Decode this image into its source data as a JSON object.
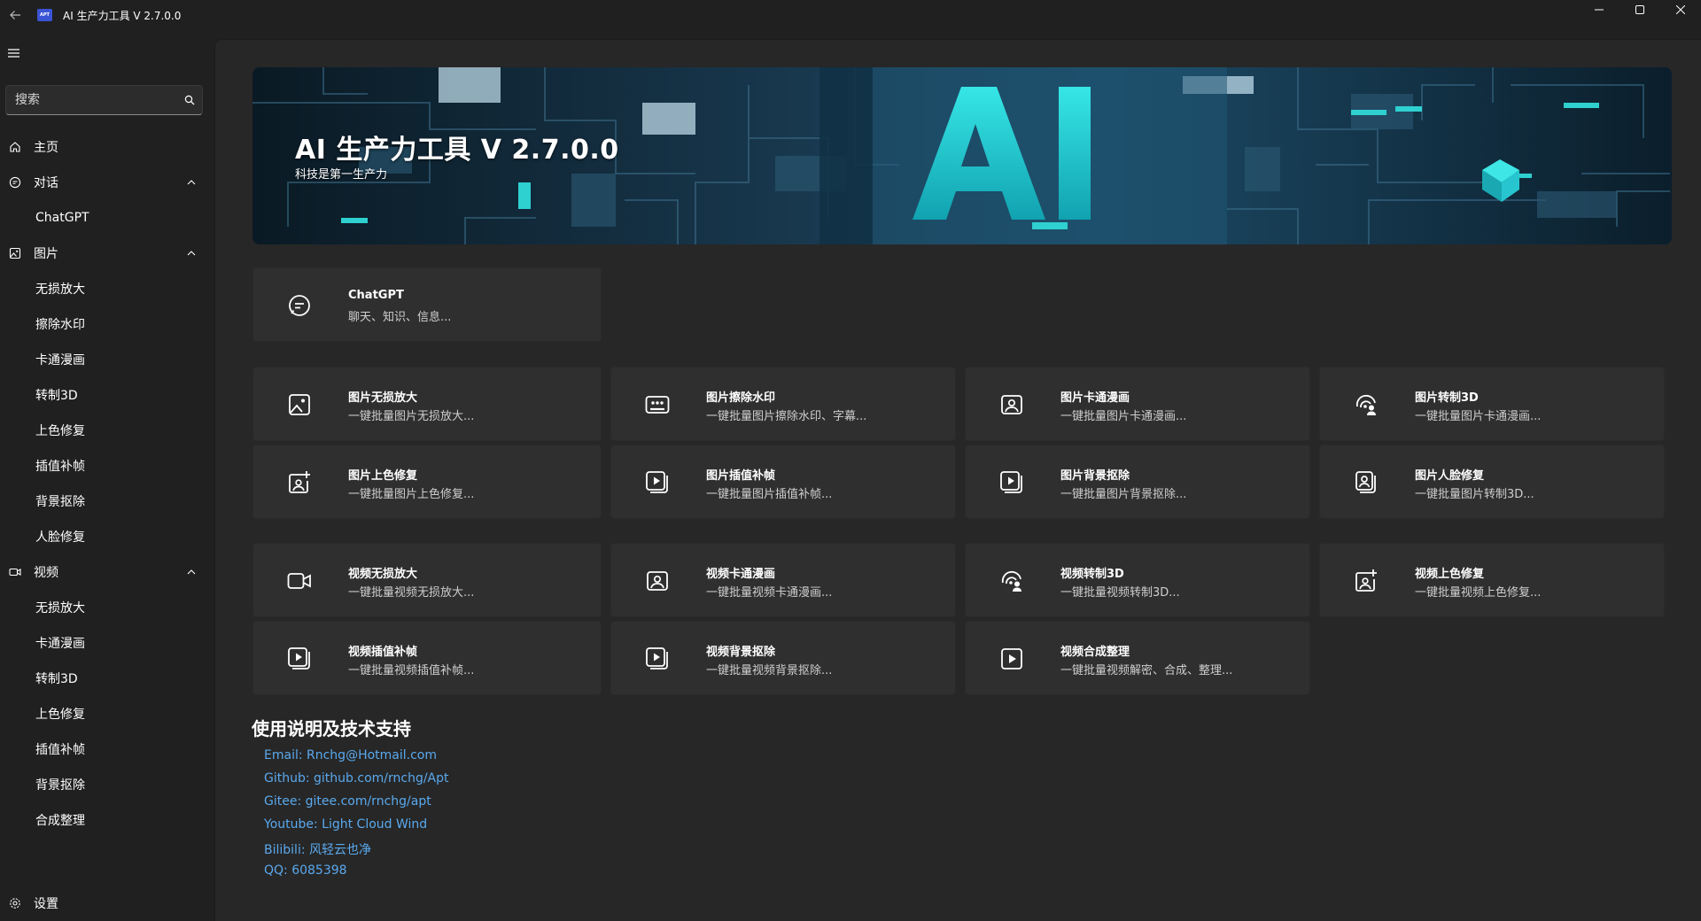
{
  "window": {
    "title": "AI 生产力工具 V 2.7.0.0",
    "logo_text": "APT"
  },
  "search": {
    "placeholder": "搜索"
  },
  "nav": {
    "home": "主页",
    "chat": {
      "label": "对话",
      "items": [
        "ChatGPT"
      ]
    },
    "image": {
      "label": "图片",
      "items": [
        "无损放大",
        "擦除水印",
        "卡通漫画",
        "转制3D",
        "上色修复",
        "插值补帧",
        "背景抠除",
        "人脸修复"
      ]
    },
    "video": {
      "label": "视频",
      "items": [
        "无损放大",
        "卡通漫画",
        "转制3D",
        "上色修复",
        "插值补帧",
        "背景抠除",
        "合成整理"
      ]
    },
    "settings": "设置"
  },
  "hero": {
    "title": "AI 生产力工具 V 2.7.0.0",
    "subtitle": "科技是第一生产力"
  },
  "cards": {
    "chatgpt": {
      "title": "ChatGPT",
      "desc": "聊天、知识、信息...",
      "icon": "chat-icon"
    },
    "image": [
      {
        "title": "图片无损放大",
        "desc": "一键批量图片无损放大...",
        "icon": "image-icon"
      },
      {
        "title": "图片擦除水印",
        "desc": "一键批量图片擦除水印、字幕...",
        "icon": "photo-grid-icon"
      },
      {
        "title": "图片卡通漫画",
        "desc": "一键批量图片卡通漫画...",
        "icon": "portrait-icon"
      },
      {
        "title": "图片转制3D",
        "desc": "一键批量图片卡通漫画...",
        "icon": "radar-person-icon"
      },
      {
        "title": "图片上色修复",
        "desc": "一键批量图片上色修复...",
        "icon": "image-sparkle-icon"
      },
      {
        "title": "图片插值补帧",
        "desc": "一键批量图片插值补帧...",
        "icon": "play-frames-icon"
      },
      {
        "title": "图片背景抠除",
        "desc": "一键批量图片背景抠除...",
        "icon": "play-frames-icon"
      },
      {
        "title": "图片人脸修复",
        "desc": "一键批量图片转制3D...",
        "icon": "face-icon"
      }
    ],
    "video": [
      {
        "title": "视频无损放大",
        "desc": "一键批量视频无损放大...",
        "icon": "video-camera-icon"
      },
      {
        "title": "视频卡通漫画",
        "desc": "一键批量视频卡通漫画...",
        "icon": "portrait-icon"
      },
      {
        "title": "视频转制3D",
        "desc": "一键批量视频转制3D...",
        "icon": "radar-person-icon"
      },
      {
        "title": "视频上色修复",
        "desc": "一键批量视频上色修复...",
        "icon": "image-sparkle-icon"
      },
      {
        "title": "视频插值补帧",
        "desc": "一键批量视频插值补帧...",
        "icon": "play-frames-icon"
      },
      {
        "title": "视频背景抠除",
        "desc": "一键批量视频背景抠除...",
        "icon": "play-frames-icon"
      },
      {
        "title": "视频合成整理",
        "desc": "一键批量视频解密、合成、整理...",
        "icon": "play-box-icon"
      }
    ]
  },
  "support": {
    "heading": "使用说明及技术支持",
    "links": [
      "Email: Rnchg@Hotmail.com",
      "Github: github.com/rnchg/Apt",
      "Gitee: gitee.com/rnchg/apt",
      "Youtube: Light Cloud Wind",
      "Bilibili: 风轻云也净",
      "QQ: 6085398"
    ]
  },
  "colors": {
    "background": "#202020",
    "panel": "#272727",
    "card": "#2f2f2f",
    "link": "#5aa9ee",
    "accent": "#2fd0d0"
  }
}
